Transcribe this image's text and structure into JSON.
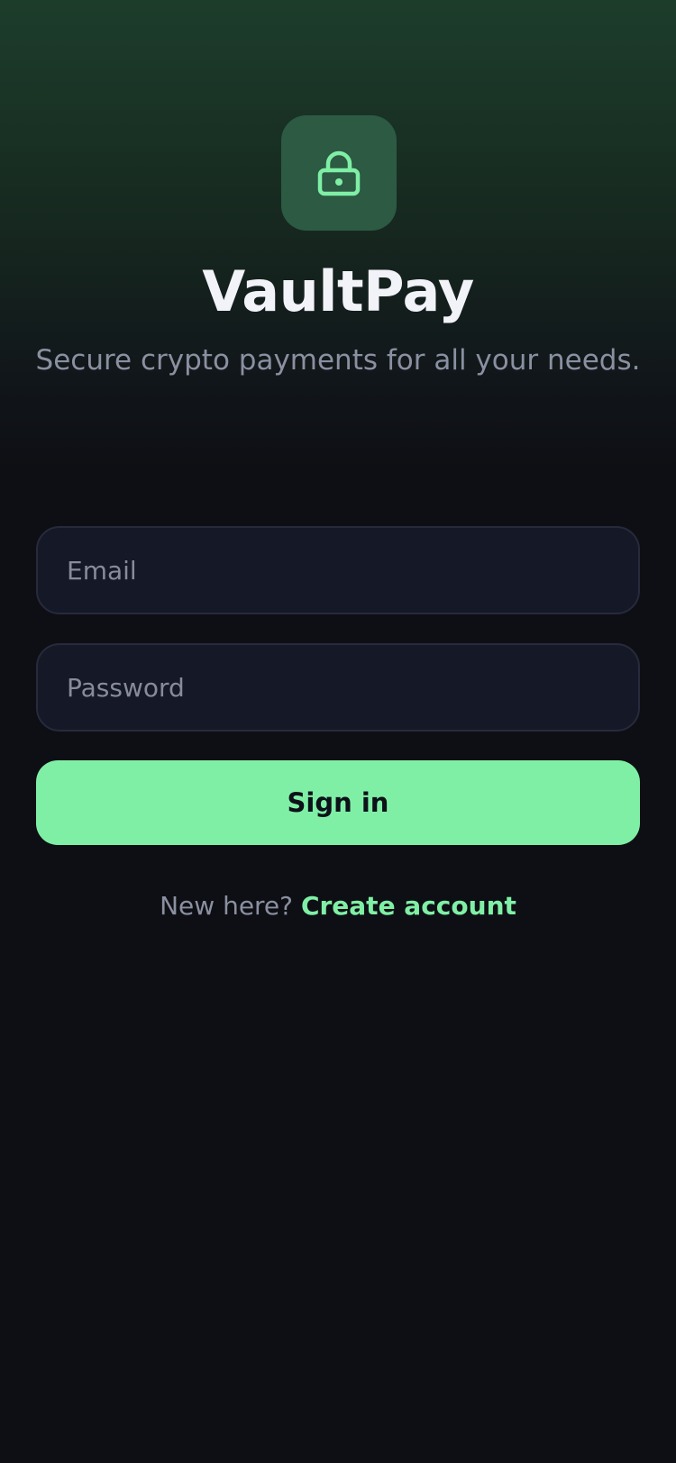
{
  "brand": {
    "icon": "lock-icon",
    "title": "VaultPay",
    "tagline": "Secure crypto payments for all your needs."
  },
  "form": {
    "email_placeholder": "Email",
    "password_placeholder": "Password",
    "signin_label": "Sign in"
  },
  "footer": {
    "prompt": "New here?",
    "link_label": "Create account"
  },
  "colors": {
    "accent": "#80efa6",
    "background": "#0e0f14",
    "header_gradient_top": "#1d3d2b",
    "field_background": "#151827",
    "field_border": "#272a3b",
    "title_text": "#f2f3f8",
    "muted_text": "#8a90a0"
  }
}
